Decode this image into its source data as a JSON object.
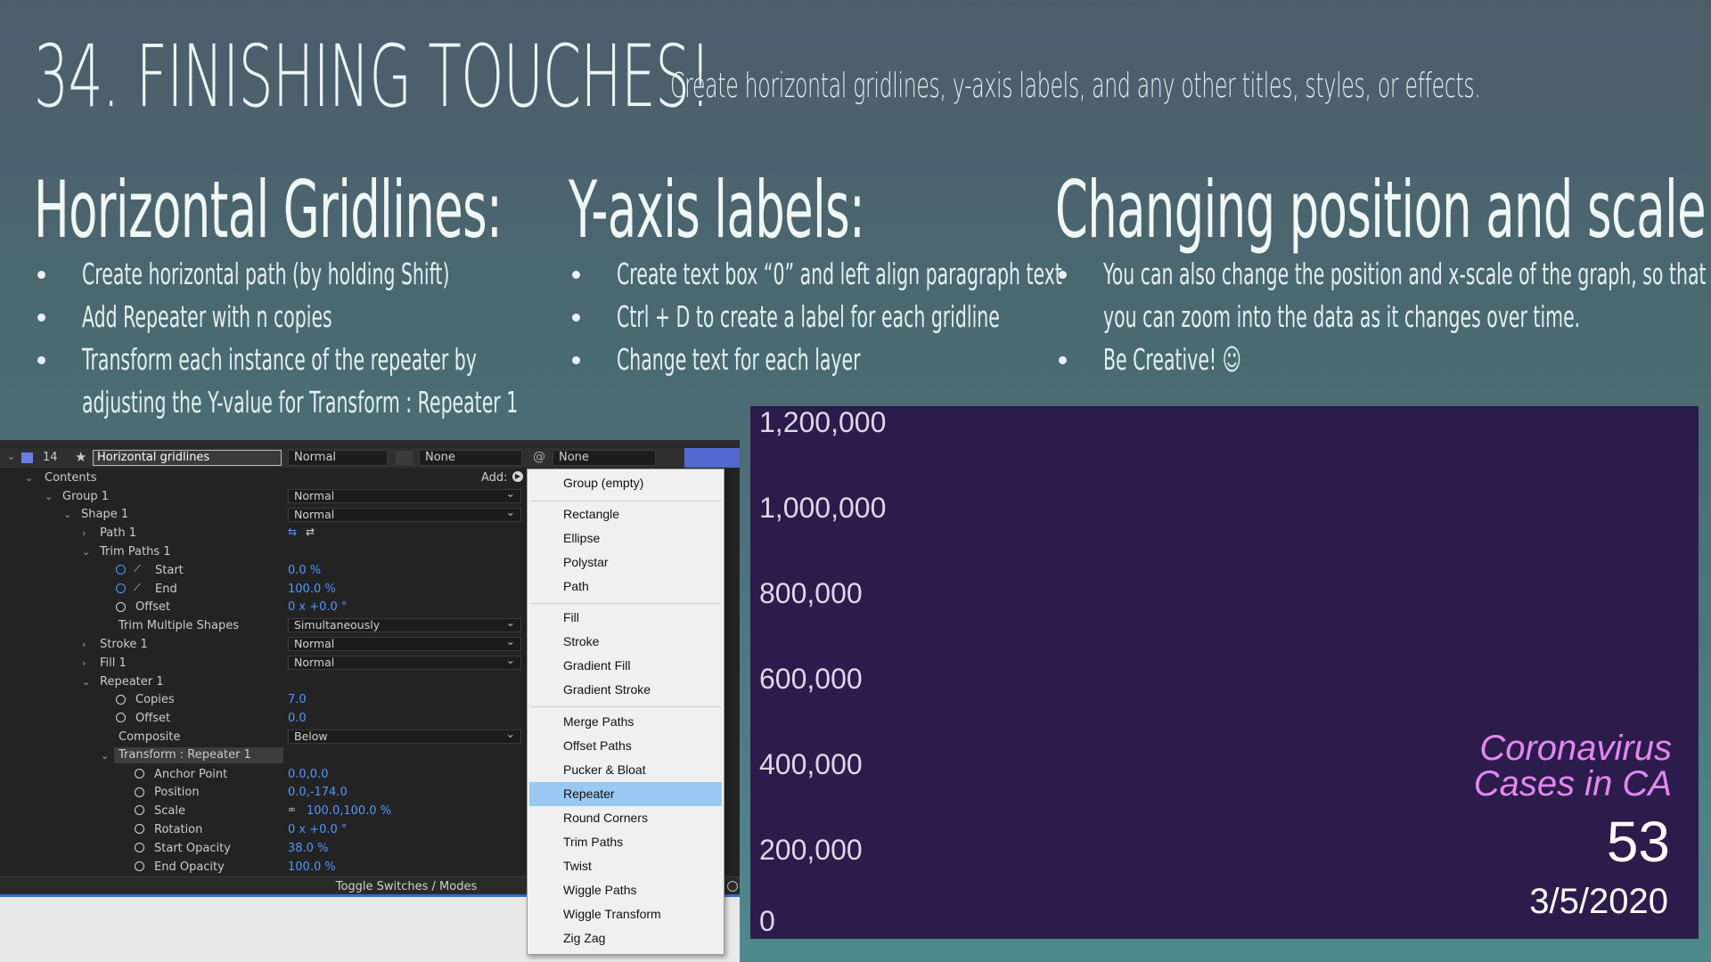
{
  "slide": {
    "title": "34. FINISHING TOUCHES!",
    "subtitle": "Create horizontal gridlines, y-axis labels, and any other titles, styles, or effects.",
    "sections": [
      {
        "heading": "Horizontal Gridlines:",
        "bullets": [
          "Create horizontal path (by holding Shift)",
          "Add Repeater with n copies",
          "Transform each instance of the repeater by",
          "adjusting the Y-value for Transform : Repeater 1"
        ]
      },
      {
        "heading": "Y-axis labels:",
        "bullets": [
          "Create text box “0” and left align paragraph text",
          "Ctrl + D to create a label for each gridline",
          "Change text for each layer"
        ]
      },
      {
        "heading": "Changing position and scale",
        "bullets": [
          "You can also change the position and x-scale of the graph, so that",
          "you can zoom into the data as it changes over time.",
          "Be Creative! ☺"
        ]
      }
    ]
  },
  "ae_panel": {
    "layer": {
      "number": "14",
      "name": "Horizontal gridlines",
      "mode": "Normal",
      "trkmat": "None",
      "parent": "None"
    },
    "add_label": "Add:",
    "rows": [
      {
        "name": "Contents"
      },
      {
        "name": "Group 1",
        "dropdown": "Normal"
      },
      {
        "name": "Shape 1",
        "dropdown": "Normal"
      },
      {
        "name": "Path 1"
      },
      {
        "name": "Trim Paths 1"
      },
      {
        "name": "Start",
        "value": "0.0 %"
      },
      {
        "name": "End",
        "value": "100.0 %"
      },
      {
        "name": "Offset",
        "value": "0 x +0.0 °"
      },
      {
        "name": "Trim Multiple Shapes",
        "dropdown": "Simultaneously"
      },
      {
        "name": "Stroke 1",
        "dropdown": "Normal"
      },
      {
        "name": "Fill 1",
        "dropdown": "Normal"
      },
      {
        "name": "Repeater 1"
      },
      {
        "name": "Copies",
        "value": "7.0"
      },
      {
        "name": "Offset",
        "value": "0.0"
      },
      {
        "name": "Composite",
        "dropdown": "Below"
      },
      {
        "name": "Transform : Repeater 1"
      },
      {
        "name": "Anchor Point",
        "value": "0.0,0.0"
      },
      {
        "name": "Position",
        "value": "0.0,-174.0"
      },
      {
        "name": "Scale",
        "value": "100.0,100.0 %"
      },
      {
        "name": "Rotation",
        "value": "0 x +0.0 °"
      },
      {
        "name": "Start Opacity",
        "value": "38.0 %"
      },
      {
        "name": "End Opacity",
        "value": "100.0 %"
      }
    ],
    "footer_toggle": "Toggle Switches / Modes"
  },
  "menu": {
    "items": [
      "Group (empty)",
      "Rectangle",
      "Ellipse",
      "Polystar",
      "Path",
      "Fill",
      "Stroke",
      "Gradient Fill",
      "Gradient Stroke",
      "Merge Paths",
      "Offset Paths",
      "Pucker & Bloat",
      "Repeater",
      "Round Corners",
      "Trim Paths",
      "Twist",
      "Wiggle Paths",
      "Wiggle Transform",
      "Zig Zag"
    ],
    "selected": "Repeater"
  },
  "chart_preview": {
    "y_ticks": [
      "1,200,000",
      "1,000,000",
      "800,000",
      "600,000",
      "400,000",
      "200,000",
      "0"
    ],
    "caption_line1": "Coronavirus",
    "caption_line2": "Cases in CA",
    "count": "53",
    "date": "3/5/2020",
    "colors": {
      "background": "#2c1c4b",
      "caption": "#e287f0"
    }
  }
}
